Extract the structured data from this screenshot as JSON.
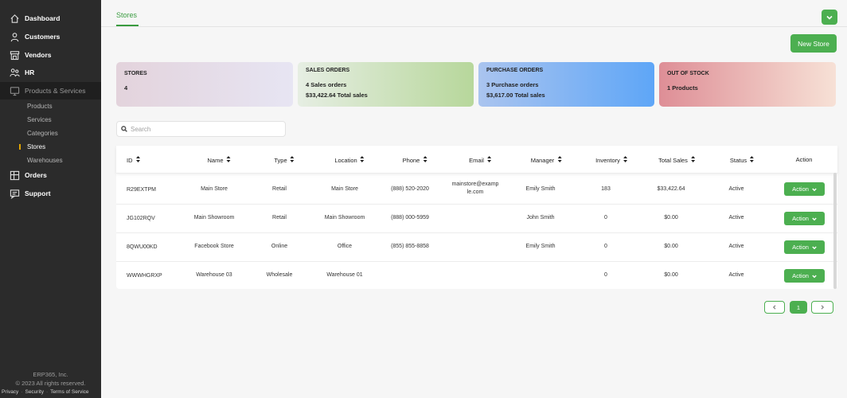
{
  "sidebar": {
    "items": [
      {
        "label": "Dashboard",
        "icon": "home-icon"
      },
      {
        "label": "Customers",
        "icon": "person-icon"
      },
      {
        "label": "Vendors",
        "icon": "storefront-icon"
      },
      {
        "label": "HR",
        "icon": "people-icon"
      },
      {
        "label": "Products & Services",
        "icon": "monitor-icon"
      },
      {
        "label": "Orders",
        "icon": "orders-icon"
      },
      {
        "label": "Support",
        "icon": "support-icon"
      }
    ],
    "subitems": [
      "Products",
      "Services",
      "Categories",
      "Stores",
      "Warehouses"
    ],
    "footer": {
      "company": "ERP365, Inc.",
      "copyright": "© 2023 All rights reserved.",
      "links": [
        "Privacy",
        "Security",
        "Terms of Service"
      ]
    }
  },
  "header": {
    "tab": "Stores",
    "new_store": "New Store"
  },
  "cards": {
    "stores": {
      "title": "STORES",
      "line1": "4"
    },
    "sales": {
      "title": "SALES ORDERS",
      "line1": "4 Sales orders",
      "line2": "$33,422.64 Total sales"
    },
    "purchase": {
      "title": "PURCHASE ORDERS",
      "line1": "3 Purchase orders",
      "line2": "$3,617.00 Total sales"
    },
    "oos": {
      "title": "OUT OF STOCK",
      "line1": "1 Products"
    }
  },
  "search": {
    "placeholder": "Search"
  },
  "table": {
    "headers": [
      "ID",
      "Name",
      "Type",
      "Location",
      "Phone",
      "Email",
      "Manager",
      "Inventory",
      "Total Sales",
      "Status",
      "Action"
    ],
    "rows": [
      {
        "id": "R29EXTPM",
        "name": "Main Store",
        "type": "Retail",
        "location": "Main Store",
        "phone": "(888) 520-2020",
        "email": "mainstore@example.com",
        "manager": "Emily Smith",
        "inventory": "183",
        "total_sales": "$33,422.64",
        "status": "Active",
        "action": "Action"
      },
      {
        "id": "JG102RQV",
        "name": "Main Showroom",
        "type": "Retail",
        "location": "Main Showroom",
        "phone": "(888) 000-5959",
        "email": "",
        "manager": "John Smith",
        "inventory": "0",
        "total_sales": "$0.00",
        "status": "Active",
        "action": "Action"
      },
      {
        "id": "8QWU00KD",
        "name": "Facebook Store",
        "type": "Online",
        "location": "Office",
        "phone": "(855) 855-8858",
        "email": "",
        "manager": "Emily Smith",
        "inventory": "0",
        "total_sales": "$0.00",
        "status": "Active",
        "action": "Action"
      },
      {
        "id": "WWWHGRXP",
        "name": "Warehouse 03",
        "type": "Wholesale",
        "location": "Warehouse 01",
        "phone": "",
        "email": "",
        "manager": "",
        "inventory": "0",
        "total_sales": "$0.00",
        "status": "Active",
        "action": "Action"
      }
    ]
  },
  "pagination": {
    "current": "1"
  },
  "colors": {
    "accent": "#4caf50",
    "sidebar": "#2b2b2b"
  }
}
